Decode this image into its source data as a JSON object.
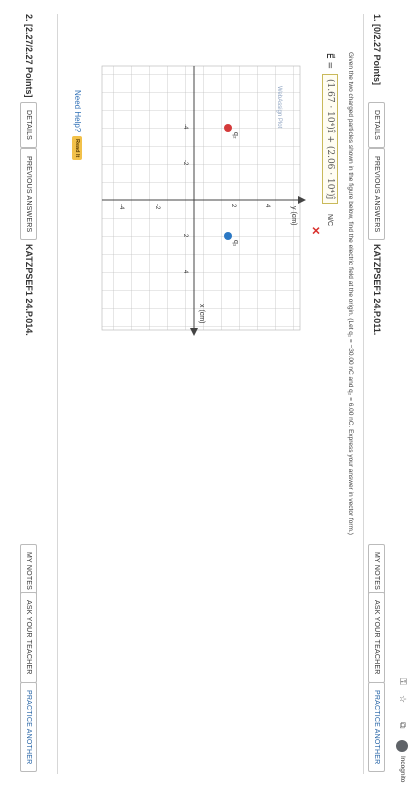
{
  "browser": {
    "incognito_label": "Incognito"
  },
  "q1": {
    "title": "1.  [0/2.27 Points]",
    "details": "DETAILS",
    "previous_answers": "PREVIOUS ANSWERS",
    "code": "KATZPSEF1 24.P.011.",
    "my_notes": "MY NOTES",
    "ask_teacher": "ASK YOUR TEACHER",
    "practice_another": "PRACTICE ANOTHER",
    "prompt": "Given the two charged particles shown in the figure below, find the electric field at the origin. (Let q₁ = −30.00 nC and q₂ = 6.00 nC. Express your answer in vector form.)",
    "e_label": "E⃗ =",
    "answer_value": "(1.67 · 10⁴)î + (2.06 · 10⁴)ĵ",
    "unit": "N/C",
    "wrong_mark": "✕",
    "figure": {
      "watermark": "WebAssign Plot",
      "y_axis_label": "y (cm)",
      "x_axis_label": "x (cm)",
      "ticks": [
        "4",
        "2",
        "-2",
        "-4",
        "2",
        "4",
        "-2",
        "-4"
      ],
      "q1_label": "q₁",
      "q2_label": "q₂",
      "q1_color": "#2b78c4",
      "q2_color": "#d43a3a"
    },
    "need_help": "Need Help?",
    "read_it": "Read It"
  },
  "q2": {
    "title": "2.  [2.27/2.27 Points]",
    "details": "DETAILS",
    "previous_answers": "PREVIOUS ANSWERS",
    "code": "KATZPSEF1 24.P.014.",
    "my_notes": "MY NOTES",
    "ask_teacher": "ASK YOUR TEACHER",
    "practice_another": "PRACTICE ANOTHER"
  }
}
